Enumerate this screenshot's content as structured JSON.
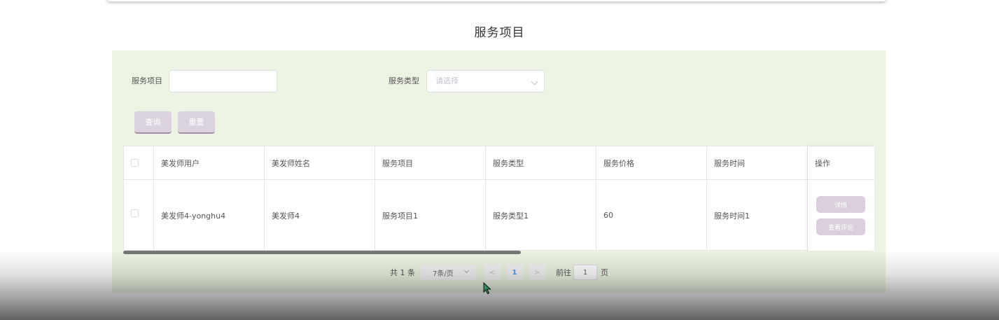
{
  "page": {
    "title": "服务项目"
  },
  "search": {
    "item_label": "服务项目",
    "item_value": "",
    "type_label": "服务类型",
    "type_placeholder": "请选择",
    "query_label": "查询",
    "reset_label": "重置"
  },
  "table": {
    "headers": [
      "美发师用户",
      "美发师姓名",
      "服务项目",
      "服务类型",
      "服务价格",
      "服务时间",
      "操作"
    ],
    "rows": [
      {
        "cells": [
          "美发师4-yonghu4",
          "美发师4",
          "服务项目1",
          "服务类型1",
          "60",
          "服务时间1"
        ]
      }
    ],
    "actions": {
      "detail": "详情",
      "review": "查看评论"
    }
  },
  "pagination": {
    "total": "共 1 条",
    "page_size": "7条/页",
    "prev": "<",
    "current": "1",
    "next": ">",
    "goto_label": "前往",
    "goto_value": "1",
    "page_suffix": "页"
  },
  "colors": {
    "panel_bg": "#edf4e3",
    "button_bg": "#dbd3dd",
    "active_page": "#409eff"
  }
}
